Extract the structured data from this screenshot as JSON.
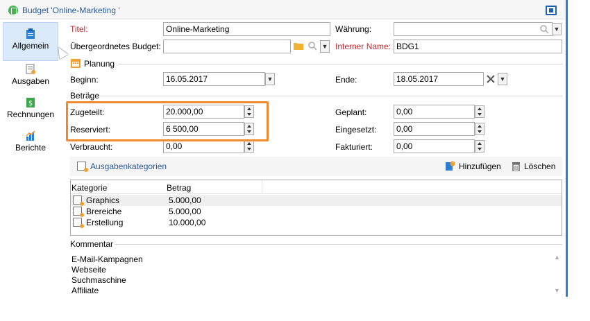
{
  "window": {
    "title": "Budget 'Online-Marketing '"
  },
  "sidebar": {
    "items": [
      {
        "label": "Allgemein",
        "icon": "clipboard-icon",
        "active": true
      },
      {
        "label": "Ausgaben",
        "icon": "expenses-icon"
      },
      {
        "label": "Rechnungen",
        "icon": "invoice-icon"
      },
      {
        "label": "Berichte",
        "icon": "chart-icon"
      }
    ]
  },
  "form": {
    "titel_label": "Titel:",
    "titel_value": "Online-Marketing",
    "waehrung_label": "Währung:",
    "waehrung_value": "",
    "parent_label": "Übergeordnetes Budget:",
    "parent_value": "",
    "internal_label": "Interner Name:",
    "internal_value": "BDG1"
  },
  "planning": {
    "section": "Planung",
    "begin_label": "Beginn:",
    "begin_value": "16.05.2017",
    "end_label": "Ende:",
    "end_value": "18.05.2017"
  },
  "amounts": {
    "section": "Beträge",
    "zugeteilt_label": "Zugeteilt:",
    "zugeteilt_value": "20.000,00",
    "reserviert_label": "Reserviert:",
    "reserviert_value": "6 500,00",
    "verbraucht_label": "Verbraucht:",
    "verbraucht_value": "0,00",
    "geplant_label": "Geplant:",
    "geplant_value": "0,00",
    "eingesetzt_label": "Eingesetzt:",
    "eingesetzt_value": "0,00",
    "fakturiert_label": "Fakturiert:",
    "fakturiert_value": "0,00"
  },
  "categories": {
    "title": "Ausgabenkategorien",
    "add_label": "Hinzufügen",
    "delete_label": "Löschen",
    "col_category": "Kategorie",
    "col_amount": "Betrag",
    "rows": [
      {
        "name": "Graphics",
        "amount": "5.000,00"
      },
      {
        "name": "Brereiche",
        "amount": "5.000,00"
      },
      {
        "name": "Erstellung",
        "amount": "10.000,00"
      }
    ]
  },
  "comment": {
    "section": "Kommentar",
    "lines": [
      "E-Mail-Kampagnen",
      "Webseite",
      "Suchmaschine",
      "Affiliate"
    ]
  },
  "colors": {
    "accent": "#2b7fd4",
    "highlight": "#f08a2c",
    "required": "#c0282d",
    "link": "#2a5a9e"
  }
}
